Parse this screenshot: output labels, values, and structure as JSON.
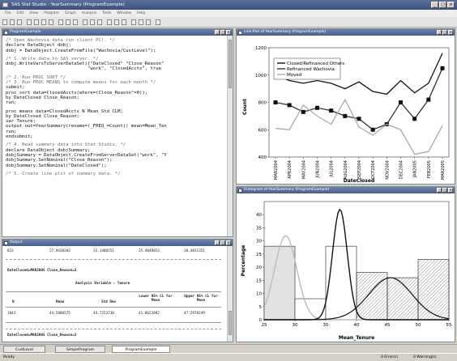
{
  "app": {
    "title": "SAS Stat Studio - YearSummary (ProgramExample)"
  },
  "menu": [
    "File",
    "Edit",
    "View",
    "Program",
    "Graph",
    "Analysis",
    "Tools",
    "Window",
    "Help"
  ],
  "program_window": {
    "title": "ProgramExample",
    "lines": [
      {
        "t": "/* Open Wachovia data (on client PC). */",
        "c": true
      },
      {
        "t": "declare DataObject dobj;"
      },
      {
        "t": "dobj = DataObject.CreateFromFile(\"Wachovia/CustLevel\");"
      },
      {
        "t": "",
        "b": true
      },
      {
        "t": "/* 1. Write data to SAS server. */",
        "c": true
      },
      {
        "t": "dobj.WriteVarsToServerDataSet({\"DateClosed\" \"Close_Reason\""
      },
      {
        "t": "                              \"work\", \"ClosedAccts\", true"
      },
      {
        "t": "",
        "b": true
      },
      {
        "t": "/* 2. Run PROC SORT */",
        "c": true
      },
      {
        "t": "/* 3. Run PROC MEANS to compute means for each month */",
        "c": true
      },
      {
        "t": "submit;"
      },
      {
        "t": "proc sort data=ClosedAccts(where=(Close_Reason^=0));"
      },
      {
        "t": "by DateClosed Close_Reason;"
      },
      {
        "t": "run;"
      },
      {
        "t": "",
        "b": true
      },
      {
        "t": "proc means data=ClosedAccts N Mean Std CLM;"
      },
      {
        "t": "by DateClosed Close_Reason;"
      },
      {
        "t": "var Tenure;"
      },
      {
        "t": "output out=YearSummary(rename=(_FREQ_=Count)) mean=Mean_Ten"
      },
      {
        "t": "run;"
      },
      {
        "t": "endsubmit;"
      },
      {
        "t": "",
        "b": true
      },
      {
        "t": "/* 4. Read summary data into Stat Studio. */",
        "c": true
      },
      {
        "t": "declare DataObject dobjSummary;"
      },
      {
        "t": "dobjSummary = DataObject.CreateFromServerDataSet(\"work\", \"Y"
      },
      {
        "t": "dobjSummary.SetNominal(\"Close_Reason\");"
      },
      {
        "t": "dobjSummary.SetNominal(\"DateClosed\");"
      },
      {
        "t": "",
        "b": true
      },
      {
        "t": "/* 5. Create line plot of summary data. */",
        "c": true
      }
    ]
  },
  "output_window": {
    "title": "Output",
    "top_row": [
      "823",
      "27.9438202",
      "32.1486551",
      "25.4049053",
      "30.4811351"
    ],
    "by_line_1": "DateClosed=MAR2005 Close_Reason=2",
    "analysis_title": "Analysis Variable : Tenure",
    "headers": [
      "N",
      "Mean",
      "Std Dev",
      "Lower 95% CL for Mean",
      "Upper 95% CL for Mean"
    ],
    "row": [
      "1043",
      "44.5800575",
      "44.7253730",
      "41.8623882",
      "47.2978249"
    ],
    "by_line_2": "DateClosed=MAR2005 Close_Reason=3"
  },
  "line_window": {
    "title": "Line Plot of YearSummary (ProgramExample)"
  },
  "hist_window": {
    "title": "Histogram of YearSummary (ProgramExample)"
  },
  "chart_data": [
    {
      "type": "line",
      "x": [
        "MAR2004",
        "APR2004",
        "MAY2004",
        "JUN2004",
        "JUL2004",
        "AUG2004",
        "SEP2004",
        "OCT2004",
        "NOV2004",
        "DEC2004",
        "JAN2005",
        "FEB2005",
        "MAR2005"
      ],
      "series": [
        {
          "name": "Closed/Refinanced Others",
          "values": [
            1000,
            960,
            940,
            960,
            940,
            900,
            950,
            880,
            860,
            960,
            870,
            940,
            1160
          ]
        },
        {
          "name": "Refinanced Wachovia",
          "values": [
            800,
            780,
            730,
            760,
            740,
            700,
            680,
            600,
            640,
            800,
            680,
            820,
            1050
          ]
        },
        {
          "name": "Moved",
          "values": [
            610,
            600,
            780,
            700,
            640,
            820,
            620,
            560,
            640,
            600,
            420,
            440,
            630
          ]
        }
      ],
      "xlabel": "DateClosed",
      "ylabel": "Count",
      "ylim": [
        400,
        1200
      ],
      "yticks": [
        400,
        600,
        800,
        1000,
        1200
      ],
      "legend": "top-left",
      "colors": [
        "#111111",
        "#333333",
        "#aaaaaa"
      ]
    },
    {
      "type": "bar",
      "bins": [
        [
          25,
          30
        ],
        [
          30,
          35
        ],
        [
          35,
          40
        ],
        [
          40,
          45
        ],
        [
          45,
          50
        ],
        [
          50,
          55
        ]
      ],
      "series": [
        {
          "values": [
            28,
            0,
            0,
            0,
            0,
            0
          ]
        },
        {
          "values": [
            0,
            8,
            0,
            0,
            0,
            0
          ]
        },
        {
          "values": [
            0,
            0,
            28,
            0,
            0,
            0
          ]
        },
        {
          "values": [
            0,
            0,
            0,
            18,
            16,
            23
          ]
        }
      ],
      "xlabel": "Mean_Tenure",
      "ylabel": "Percentage",
      "xlim": [
        25,
        55
      ],
      "xticks": [
        25,
        30,
        35,
        40,
        45,
        50,
        55
      ],
      "ylim": [
        0,
        45
      ],
      "yticks": [
        0,
        5,
        10,
        15,
        20,
        25,
        30,
        35,
        40
      ],
      "curves": [
        {
          "mu": 28.5,
          "sigma": 1.8,
          "peak": 32
        },
        {
          "mu": 37.3,
          "sigma": 1.2,
          "peak": 42
        },
        {
          "mu": 45.5,
          "sigma": 3.5,
          "peak": 16
        }
      ]
    }
  ],
  "tabs": [
    "CustLevel",
    "SimpleProgram",
    "ProgramExample"
  ],
  "status": {
    "left": "Ready",
    "errors": "0 Error(s)",
    "warnings": "0 Warning(s)"
  }
}
